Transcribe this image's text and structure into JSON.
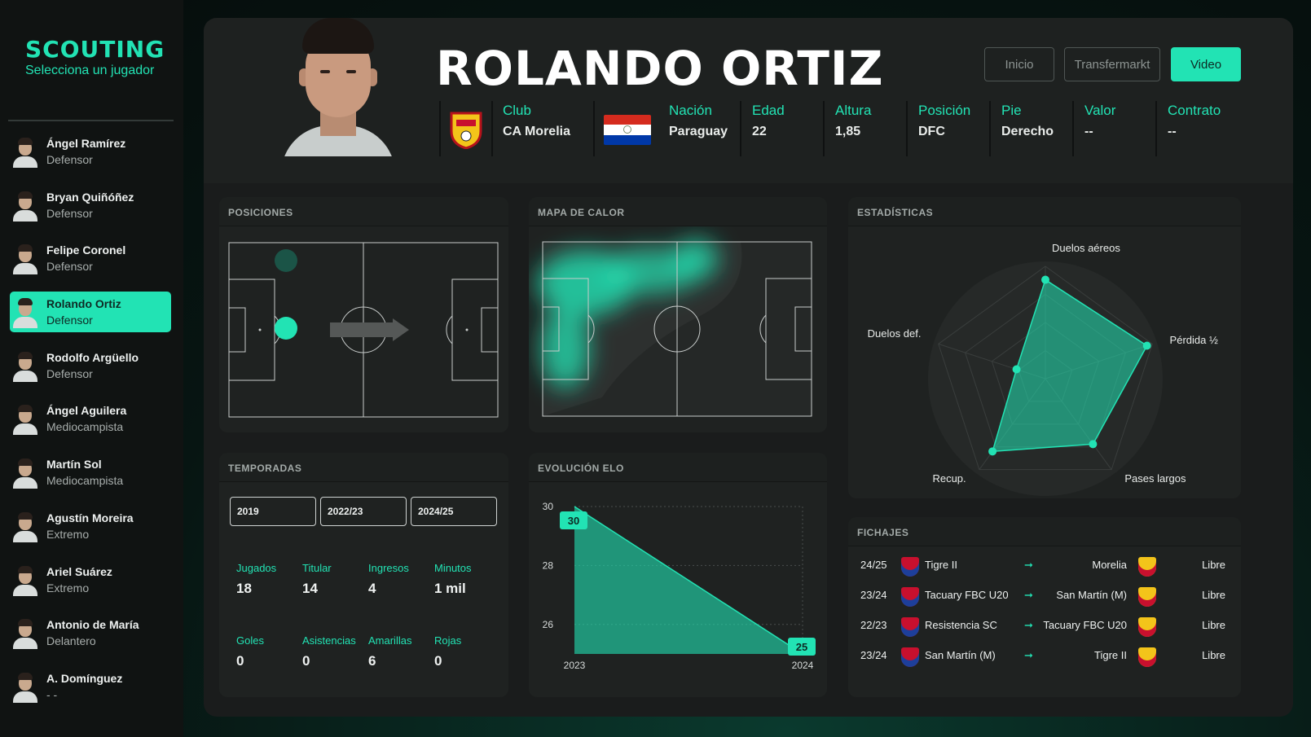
{
  "sidebar": {
    "title": "SCOUTING",
    "subtitle": "Selecciona un jugador",
    "players": [
      {
        "name": "Ángel Ramírez",
        "position": "Defensor"
      },
      {
        "name": "Bryan Quiñóñez",
        "position": "Defensor"
      },
      {
        "name": "Felipe Coronel",
        "position": "Defensor"
      },
      {
        "name": "Rolando Ortiz",
        "position": "Defensor",
        "active": true
      },
      {
        "name": "Rodolfo Argüello",
        "position": "Defensor"
      },
      {
        "name": "Ángel Aguilera",
        "position": "Mediocampista"
      },
      {
        "name": "Martín Sol",
        "position": "Mediocampista"
      },
      {
        "name": "Agustín Moreira",
        "position": "Extremo"
      },
      {
        "name": "Ariel Suárez",
        "position": "Extremo"
      },
      {
        "name": "Antonio de María",
        "position": "Delantero"
      },
      {
        "name": "A. Domínguez",
        "position": "- -"
      }
    ]
  },
  "header": {
    "player_name": "ROLANDO ORTIZ",
    "buttons": {
      "inicio": "Inicio",
      "transfermarkt": "Transfermarkt",
      "video": "Video"
    },
    "info": {
      "club_label": "Club",
      "club": "CA Morelia",
      "nation_label": "Nación",
      "nation": "Paraguay",
      "age_label": "Edad",
      "age": "22",
      "height_label": "Altura",
      "height": "1,85",
      "position_label": "Posición",
      "position": "DFC",
      "foot_label": "Pie",
      "foot": "Derecho",
      "value_label": "Valor",
      "value": "--",
      "contract_label": "Contrato",
      "contract": "--"
    }
  },
  "positions": {
    "title": "POSICIONES"
  },
  "heatmap": {
    "title": "MAPA DE CALOR"
  },
  "stats": {
    "title": "ESTADÍSTICAS",
    "chart_data": {
      "type": "radar",
      "axes": [
        "Duelos aéreos",
        "Pérdida ½",
        "Pases largos",
        "Recup.",
        "Duelos def."
      ],
      "values": [
        0.88,
        0.95,
        0.72,
        0.8,
        0.27
      ],
      "color": "#22e3b4"
    }
  },
  "seasons": {
    "title": "TEMPORADAS",
    "tabs": [
      "2019",
      "2022/23",
      "2024/25"
    ],
    "items": [
      {
        "label": "Jugados",
        "value": "18"
      },
      {
        "label": "Titular",
        "value": "14"
      },
      {
        "label": "Ingresos",
        "value": "4"
      },
      {
        "label": "Minutos",
        "value": "1 mil"
      },
      {
        "label": "Goles",
        "value": "0"
      },
      {
        "label": "Asistencias",
        "value": "0"
      },
      {
        "label": "Amarillas",
        "value": "6"
      },
      {
        "label": "Rojas",
        "value": "0"
      }
    ]
  },
  "elo": {
    "title": "EVOLUCIÓN ELO",
    "chart_data": {
      "type": "area",
      "x": [
        "2023",
        "2024"
      ],
      "values": [
        30,
        25
      ],
      "ylim": [
        25,
        30
      ],
      "yticks": [
        "30",
        "28",
        "26"
      ],
      "labels": [
        "30",
        "25"
      ],
      "color": "#22e3b4"
    }
  },
  "transfers": {
    "title": "FICHAJES",
    "rows": [
      {
        "season": "24/25",
        "from": "Tigre II",
        "arrow": "➞",
        "to": "Morelia",
        "fee": "Libre"
      },
      {
        "season": "23/24",
        "from": "Tacuary FBC U20",
        "arrow": "➞",
        "to": "San Martín (M)",
        "fee": "Libre"
      },
      {
        "season": "22/23",
        "from": "Resistencia SC",
        "arrow": "➞",
        "to": "Tacuary FBC U20",
        "fee": "Libre"
      },
      {
        "season": "23/24",
        "from": "San Martín (M)",
        "arrow": "➞",
        "to": "Tigre II",
        "fee": "Libre"
      }
    ]
  },
  "colors": {
    "accent": "#22e3b4",
    "bg": "#1a1c1c"
  }
}
